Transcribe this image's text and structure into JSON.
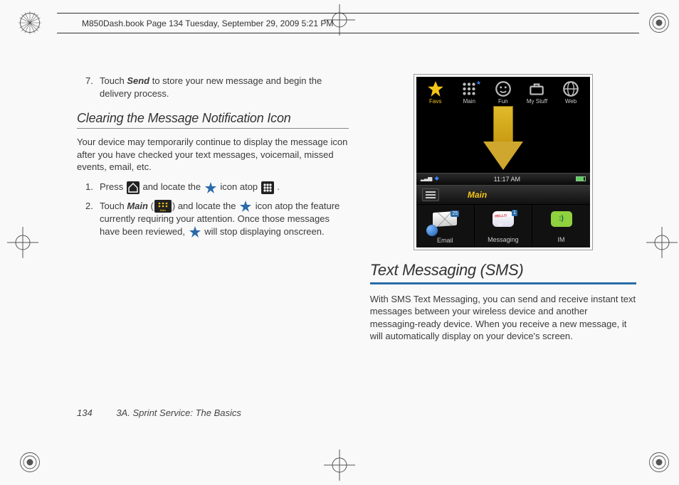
{
  "header": {
    "text": "M850Dash.book  Page 134  Tuesday, September 29, 2009  5:21 PM"
  },
  "left": {
    "step7_pre": "Touch ",
    "step7_bold": "Send",
    "step7_post": " to store your new message and begin the delivery process.",
    "sub_heading": "Clearing the Message Notification Icon",
    "intro": "Your device may temporarily continue to display the message icon after you have checked your text messages, voicemail, missed events, email, etc.",
    "s1a": "Press ",
    "s1b": " and locate the ",
    "s1c": " icon atop ",
    "s1d": ".",
    "s2a": "Touch ",
    "s2_main": "Main",
    "s2b": " (",
    "s2c": ") and locate the ",
    "s2d": " icon atop the feature currently requiring your attention. Once those messages have been reviewed, ",
    "s2e": " will stop displaying onscreen."
  },
  "phone": {
    "tabs": [
      "Favs",
      "Main",
      "Fun",
      "My Stuff",
      "Web"
    ],
    "time": "11:17 AM",
    "mainbar": "Main",
    "apps": [
      {
        "label": "Email",
        "badge": "25"
      },
      {
        "label": "Messaging",
        "badge": "1",
        "hello": "HELLO"
      },
      {
        "label": "IM",
        "face": ":)"
      }
    ]
  },
  "right": {
    "heading": "Text Messaging (SMS)",
    "para": "With SMS Text Messaging, you can send and receive instant text messages between your wireless device and another messaging-ready device. When you receive a new message, it will automatically display on your device's screen."
  },
  "footer": {
    "page": "134",
    "section": "3A. Sprint Service: The Basics"
  }
}
